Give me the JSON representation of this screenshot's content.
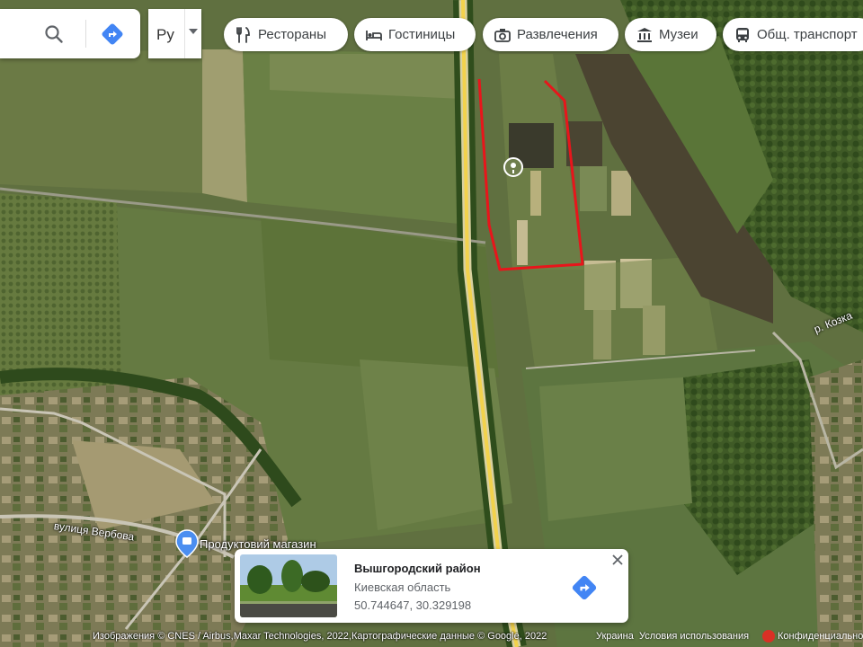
{
  "search": {
    "search_icon": "magnifier-icon",
    "directions_icon": "directions-diamond-icon"
  },
  "layer": {
    "label": "Ру"
  },
  "chips": [
    {
      "label": "Рестораны",
      "icon": "fork-knife-icon"
    },
    {
      "label": "Гостиницы",
      "icon": "bed-icon"
    },
    {
      "label": "Развлечения",
      "icon": "camera-icon"
    },
    {
      "label": "Музеи",
      "icon": "museum-icon"
    },
    {
      "label": "Общ. транспорт",
      "icon": "bus-icon"
    }
  ],
  "map_labels": {
    "shop_name": "Продуктовий магазин",
    "street_name": "вулиця Вербова",
    "river_name": "р. Козка"
  },
  "place_card": {
    "title": "Вышгородский район",
    "subtitle": "Киевская область",
    "coordinates": "50.744647, 30.329198"
  },
  "footer": {
    "attribution": "Изображения © CNES / Airbus,Maxar Technologies, 2022,Картографические данные © Google, 2022",
    "country": "Украина",
    "terms": "Условия использования",
    "privacy": "Конфиденциально"
  },
  "colors": {
    "accent_blue": "#4285f4",
    "route_red": "#e8151b",
    "road_yellow": "#f2d24c",
    "pin_blue": "#4b8ef0"
  }
}
